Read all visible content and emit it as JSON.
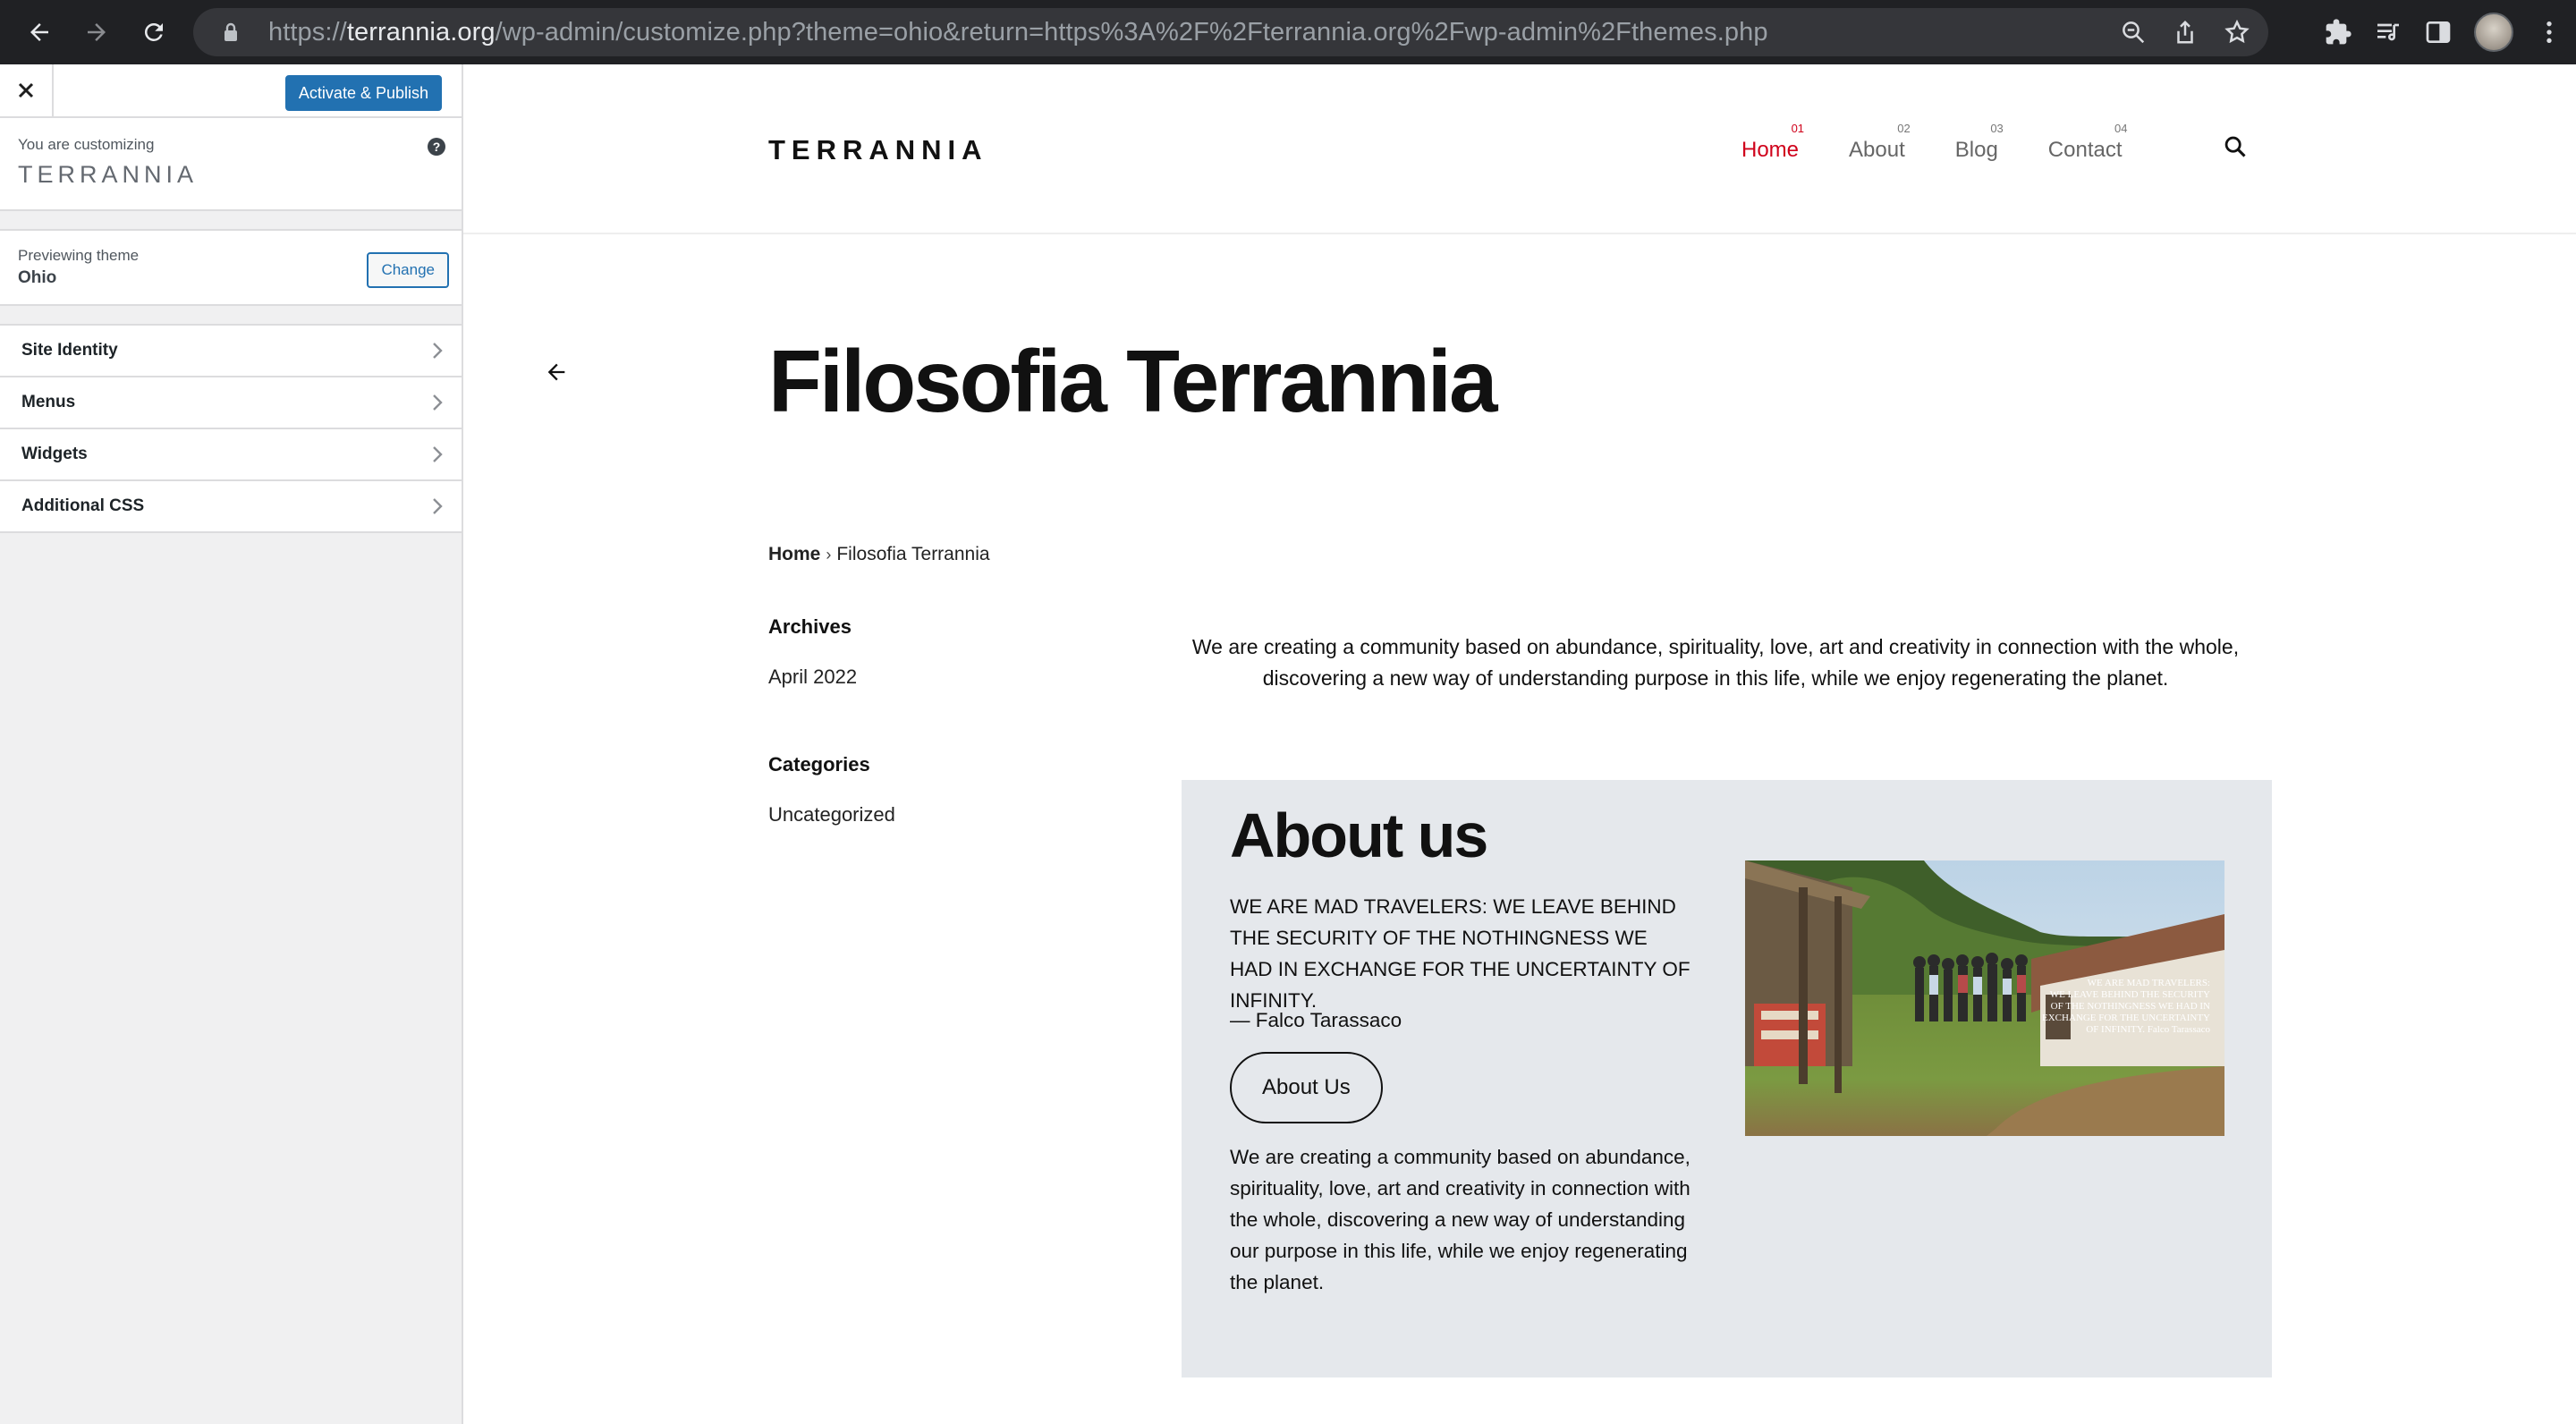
{
  "browser": {
    "url_scheme": "https://",
    "url_host": "terrannia.org",
    "url_path": "/wp-admin/customize.php?theme=ohio&return=https%3A%2F%2Fterrannia.org%2Fwp-admin%2Fthemes.php"
  },
  "customizer": {
    "publish_label": "Activate & Publish",
    "customizing_label": "You are customizing",
    "site_name": "TERRANNIA",
    "help_glyph": "?",
    "previewing_label": "Previewing theme",
    "theme_name": "Ohio",
    "change_label": "Change",
    "sections": [
      {
        "label": "Site Identity"
      },
      {
        "label": "Menus"
      },
      {
        "label": "Widgets"
      },
      {
        "label": "Additional CSS"
      }
    ]
  },
  "site": {
    "logo": "TERRANNIA",
    "nav": [
      {
        "num": "01",
        "label": "Home",
        "active": true
      },
      {
        "num": "02",
        "label": "About"
      },
      {
        "num": "03",
        "label": "Blog"
      },
      {
        "num": "04",
        "label": "Contact"
      }
    ],
    "page_title": "Filosofia Terrannia",
    "breadcrumb": {
      "home": "Home",
      "sep": "›",
      "current": "Filosofia Terrannia"
    },
    "archives_title": "Archives",
    "archives_item": "April 2022",
    "categories_title": "Categories",
    "categories_item": "Uncategorized",
    "intro_text": "We are creating a community based on abundance, spirituality, love, art and creativity in connection with the whole, discovering a new way of understanding purpose in this life, while we enjoy regenerating the planet.",
    "about": {
      "heading": "About us",
      "quote": "WE ARE MAD TRAVELERS: WE LEAVE BEHIND THE SECURITY OF THE NOTHINGNESS WE HAD IN EXCHANGE FOR THE UNCERTAINTY OF INFINITY.",
      "author": "— Falco Tarassaco",
      "button": "About Us",
      "text": "We are creating a community based on abundance, spirituality, love, art and creativity in connection with the whole, discovering a new way of understanding our purpose in this life, while we enjoy regenerating the planet.",
      "photo_caption": [
        "WE ARE MAD TRAVELERS:",
        "WE LEAVE BEHIND THE SECURITY",
        "OF THE NOTHINGNESS WE HAD IN",
        "EXCHANGE FOR THE UNCERTAINTY",
        "OF INFINITY. Falco Tarassaco"
      ]
    }
  },
  "colors": {
    "accent_red": "#d0021b",
    "wp_blue": "#2271b1",
    "about_bg": "#e5e8ec"
  }
}
